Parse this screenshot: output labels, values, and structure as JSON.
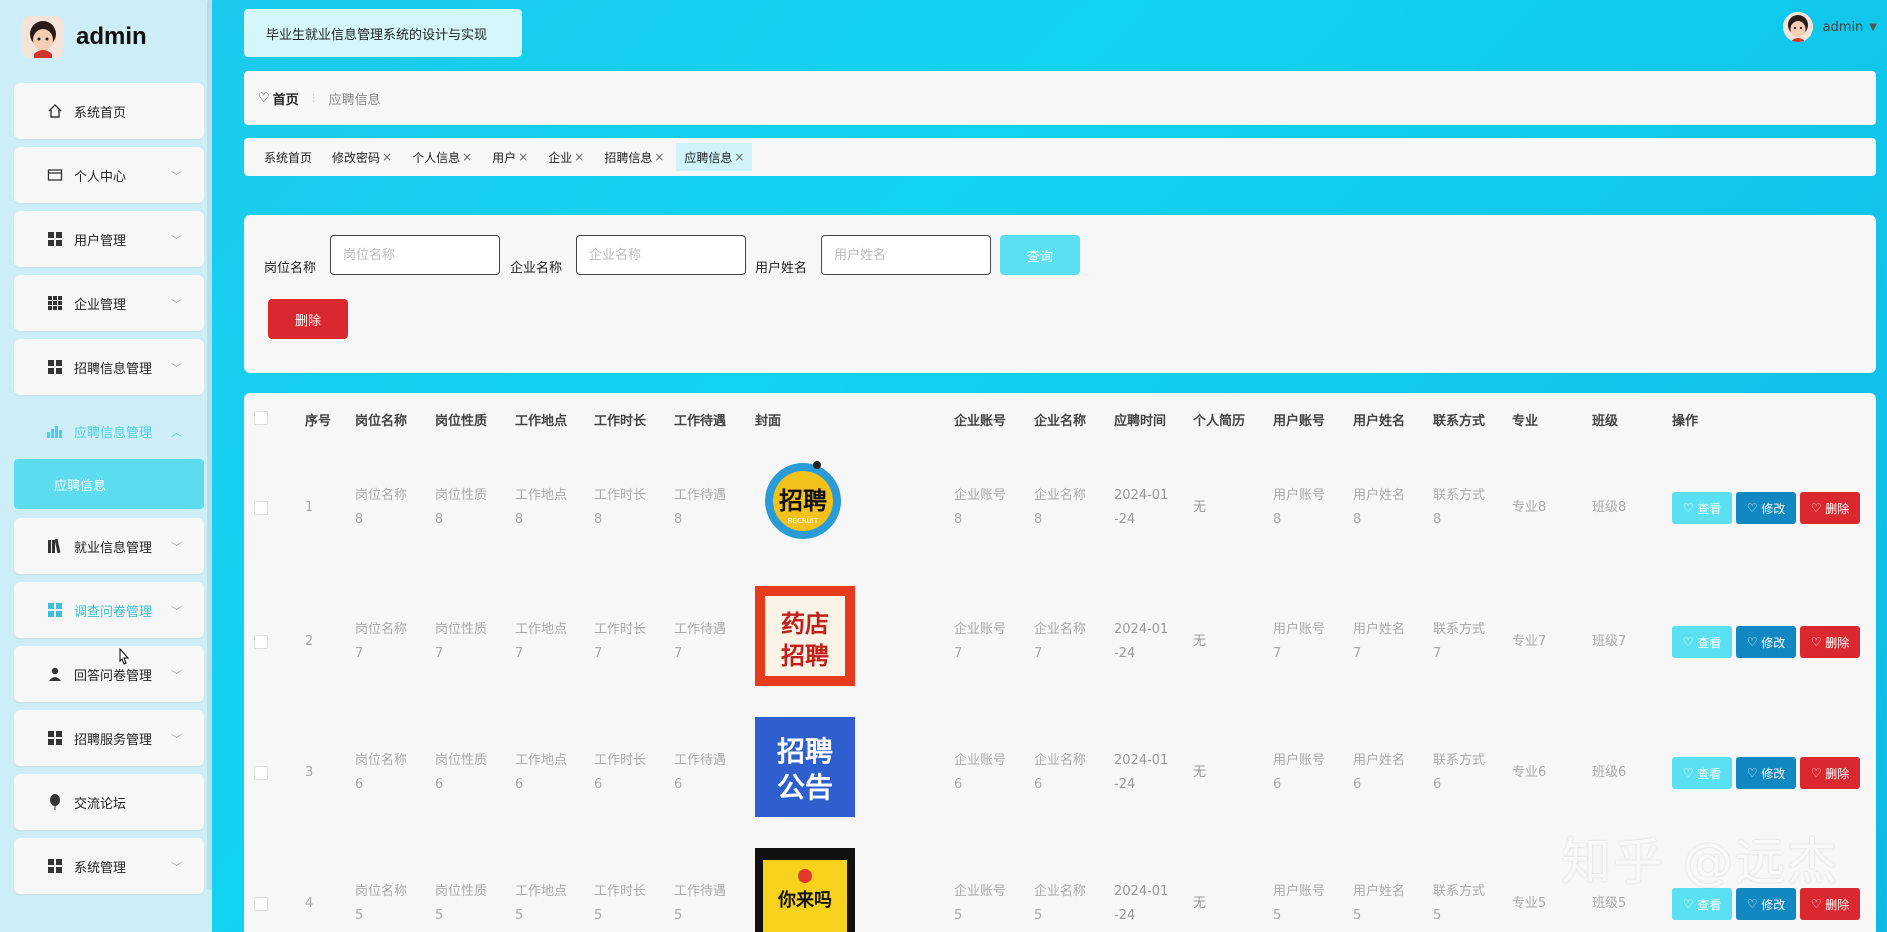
{
  "app": {
    "user_name": "admin",
    "system_title": "毕业生就业信息管理系统的设计与实现"
  },
  "sidebar": {
    "items": [
      {
        "label": "系统首页",
        "icon": "home-icon"
      },
      {
        "label": "个人中心",
        "icon": "card-icon"
      },
      {
        "label": "用户管理",
        "icon": "grid-icon"
      },
      {
        "label": "企业管理",
        "icon": "grid9-icon"
      },
      {
        "label": "招聘信息管理",
        "icon": "grid-icon"
      },
      {
        "label": "应聘信息管理",
        "icon": "chart-icon"
      },
      {
        "label": "就业信息管理",
        "icon": "books-icon"
      },
      {
        "label": "调查问卷管理",
        "icon": "grid-icon"
      },
      {
        "label": "回答问卷管理",
        "icon": "person-icon"
      },
      {
        "label": "招聘服务管理",
        "icon": "grid-icon"
      },
      {
        "label": "交流论坛",
        "icon": "balloon-icon"
      },
      {
        "label": "系统管理",
        "icon": "grid-icon"
      }
    ],
    "submenu_active": "应聘信息"
  },
  "breadcrumb": {
    "home": "首页",
    "current": "应聘信息"
  },
  "tags": [
    {
      "label": "系统首页",
      "closable": false
    },
    {
      "label": "修改密码",
      "closable": true
    },
    {
      "label": "个人信息",
      "closable": true
    },
    {
      "label": "用户",
      "closable": true
    },
    {
      "label": "企业",
      "closable": true
    },
    {
      "label": "招聘信息",
      "closable": true
    },
    {
      "label": "应聘信息",
      "closable": true
    }
  ],
  "search": {
    "job_name_label": "岗位名称",
    "job_name_placeholder": "岗位名称",
    "company_name_label": "企业名称",
    "company_name_placeholder": "企业名称",
    "user_name_label": "用户姓名",
    "user_name_placeholder": "用户姓名",
    "query_button": "查询",
    "delete_button": "删除"
  },
  "table": {
    "columns": [
      "序号",
      "岗位名称",
      "岗位性质",
      "工作地点",
      "工作时长",
      "工作待遇",
      "封面",
      "企业账号",
      "企业名称",
      "应聘时间",
      "个人简历",
      "用户账号",
      "用户姓名",
      "联系方式",
      "专业",
      "班级",
      "操作"
    ],
    "rows": [
      {
        "index": "1",
        "job_name": [
          "岗位名称",
          "8"
        ],
        "job_nature": [
          "岗位性质",
          "8"
        ],
        "location": [
          "工作地点",
          "8"
        ],
        "hours": [
          "工作时长",
          "8"
        ],
        "pay": [
          "工作待遇",
          "8"
        ],
        "cover": "招聘 RECRUIT",
        "company_account": [
          "企业账号",
          "8"
        ],
        "company_name": [
          "企业名称",
          "8"
        ],
        "apply_time": [
          "2024-01",
          "-24"
        ],
        "resume": "无",
        "user_account": [
          "用户账号",
          "8"
        ],
        "user_name": [
          "用户姓名",
          "8"
        ],
        "contact": [
          "联系方式",
          "8"
        ],
        "major": "专业8",
        "class": "班级8"
      },
      {
        "index": "2",
        "job_name": [
          "岗位名称",
          "7"
        ],
        "job_nature": [
          "岗位性质",
          "7"
        ],
        "location": [
          "工作地点",
          "7"
        ],
        "hours": [
          "工作时长",
          "7"
        ],
        "pay": [
          "工作待遇",
          "7"
        ],
        "cover": "药店招聘",
        "company_account": [
          "企业账号",
          "7"
        ],
        "company_name": [
          "企业名称",
          "7"
        ],
        "apply_time": [
          "2024-01",
          "-24"
        ],
        "resume": "无",
        "user_account": [
          "用户账号",
          "7"
        ],
        "user_name": [
          "用户姓名",
          "7"
        ],
        "contact": [
          "联系方式",
          "7"
        ],
        "major": "专业7",
        "class": "班级7"
      },
      {
        "index": "3",
        "job_name": [
          "岗位名称",
          "6"
        ],
        "job_nature": [
          "岗位性质",
          "6"
        ],
        "location": [
          "工作地点",
          "6"
        ],
        "hours": [
          "工作时长",
          "6"
        ],
        "pay": [
          "工作待遇",
          "6"
        ],
        "cover": "招聘公告",
        "company_account": [
          "企业账号",
          "6"
        ],
        "company_name": [
          "企业名称",
          "6"
        ],
        "apply_time": [
          "2024-01",
          "-24"
        ],
        "resume": "无",
        "user_account": [
          "用户账号",
          "6"
        ],
        "user_name": [
          "用户姓名",
          "6"
        ],
        "contact": [
          "联系方式",
          "6"
        ],
        "major": "专业6",
        "class": "班级6"
      },
      {
        "index": "4",
        "job_name": [
          "岗位名称",
          "5"
        ],
        "job_nature": [
          "岗位性质",
          "5"
        ],
        "location": [
          "工作地点",
          "5"
        ],
        "hours": [
          "工作时长",
          "5"
        ],
        "pay": [
          "工作待遇",
          "5"
        ],
        "cover": "你来吗",
        "company_account": [
          "企业账号",
          "5"
        ],
        "company_name": [
          "企业名称",
          "5"
        ],
        "apply_time": [
          "2024-01",
          "-24"
        ],
        "resume": "无",
        "user_account": [
          "用户账号",
          "5"
        ],
        "user_name": [
          "用户姓名",
          "5"
        ],
        "contact": [
          "联系方式",
          "5"
        ],
        "major": "专业5",
        "class": "班级5"
      }
    ],
    "actions": {
      "view": "查看",
      "edit": "修改",
      "delete": "删除"
    }
  },
  "watermark": "知乎 @远杰",
  "colors": {
    "accent": "#5ae0f0",
    "edit": "#1288c2",
    "danger": "#d9282f",
    "background": "#12d3f0"
  }
}
